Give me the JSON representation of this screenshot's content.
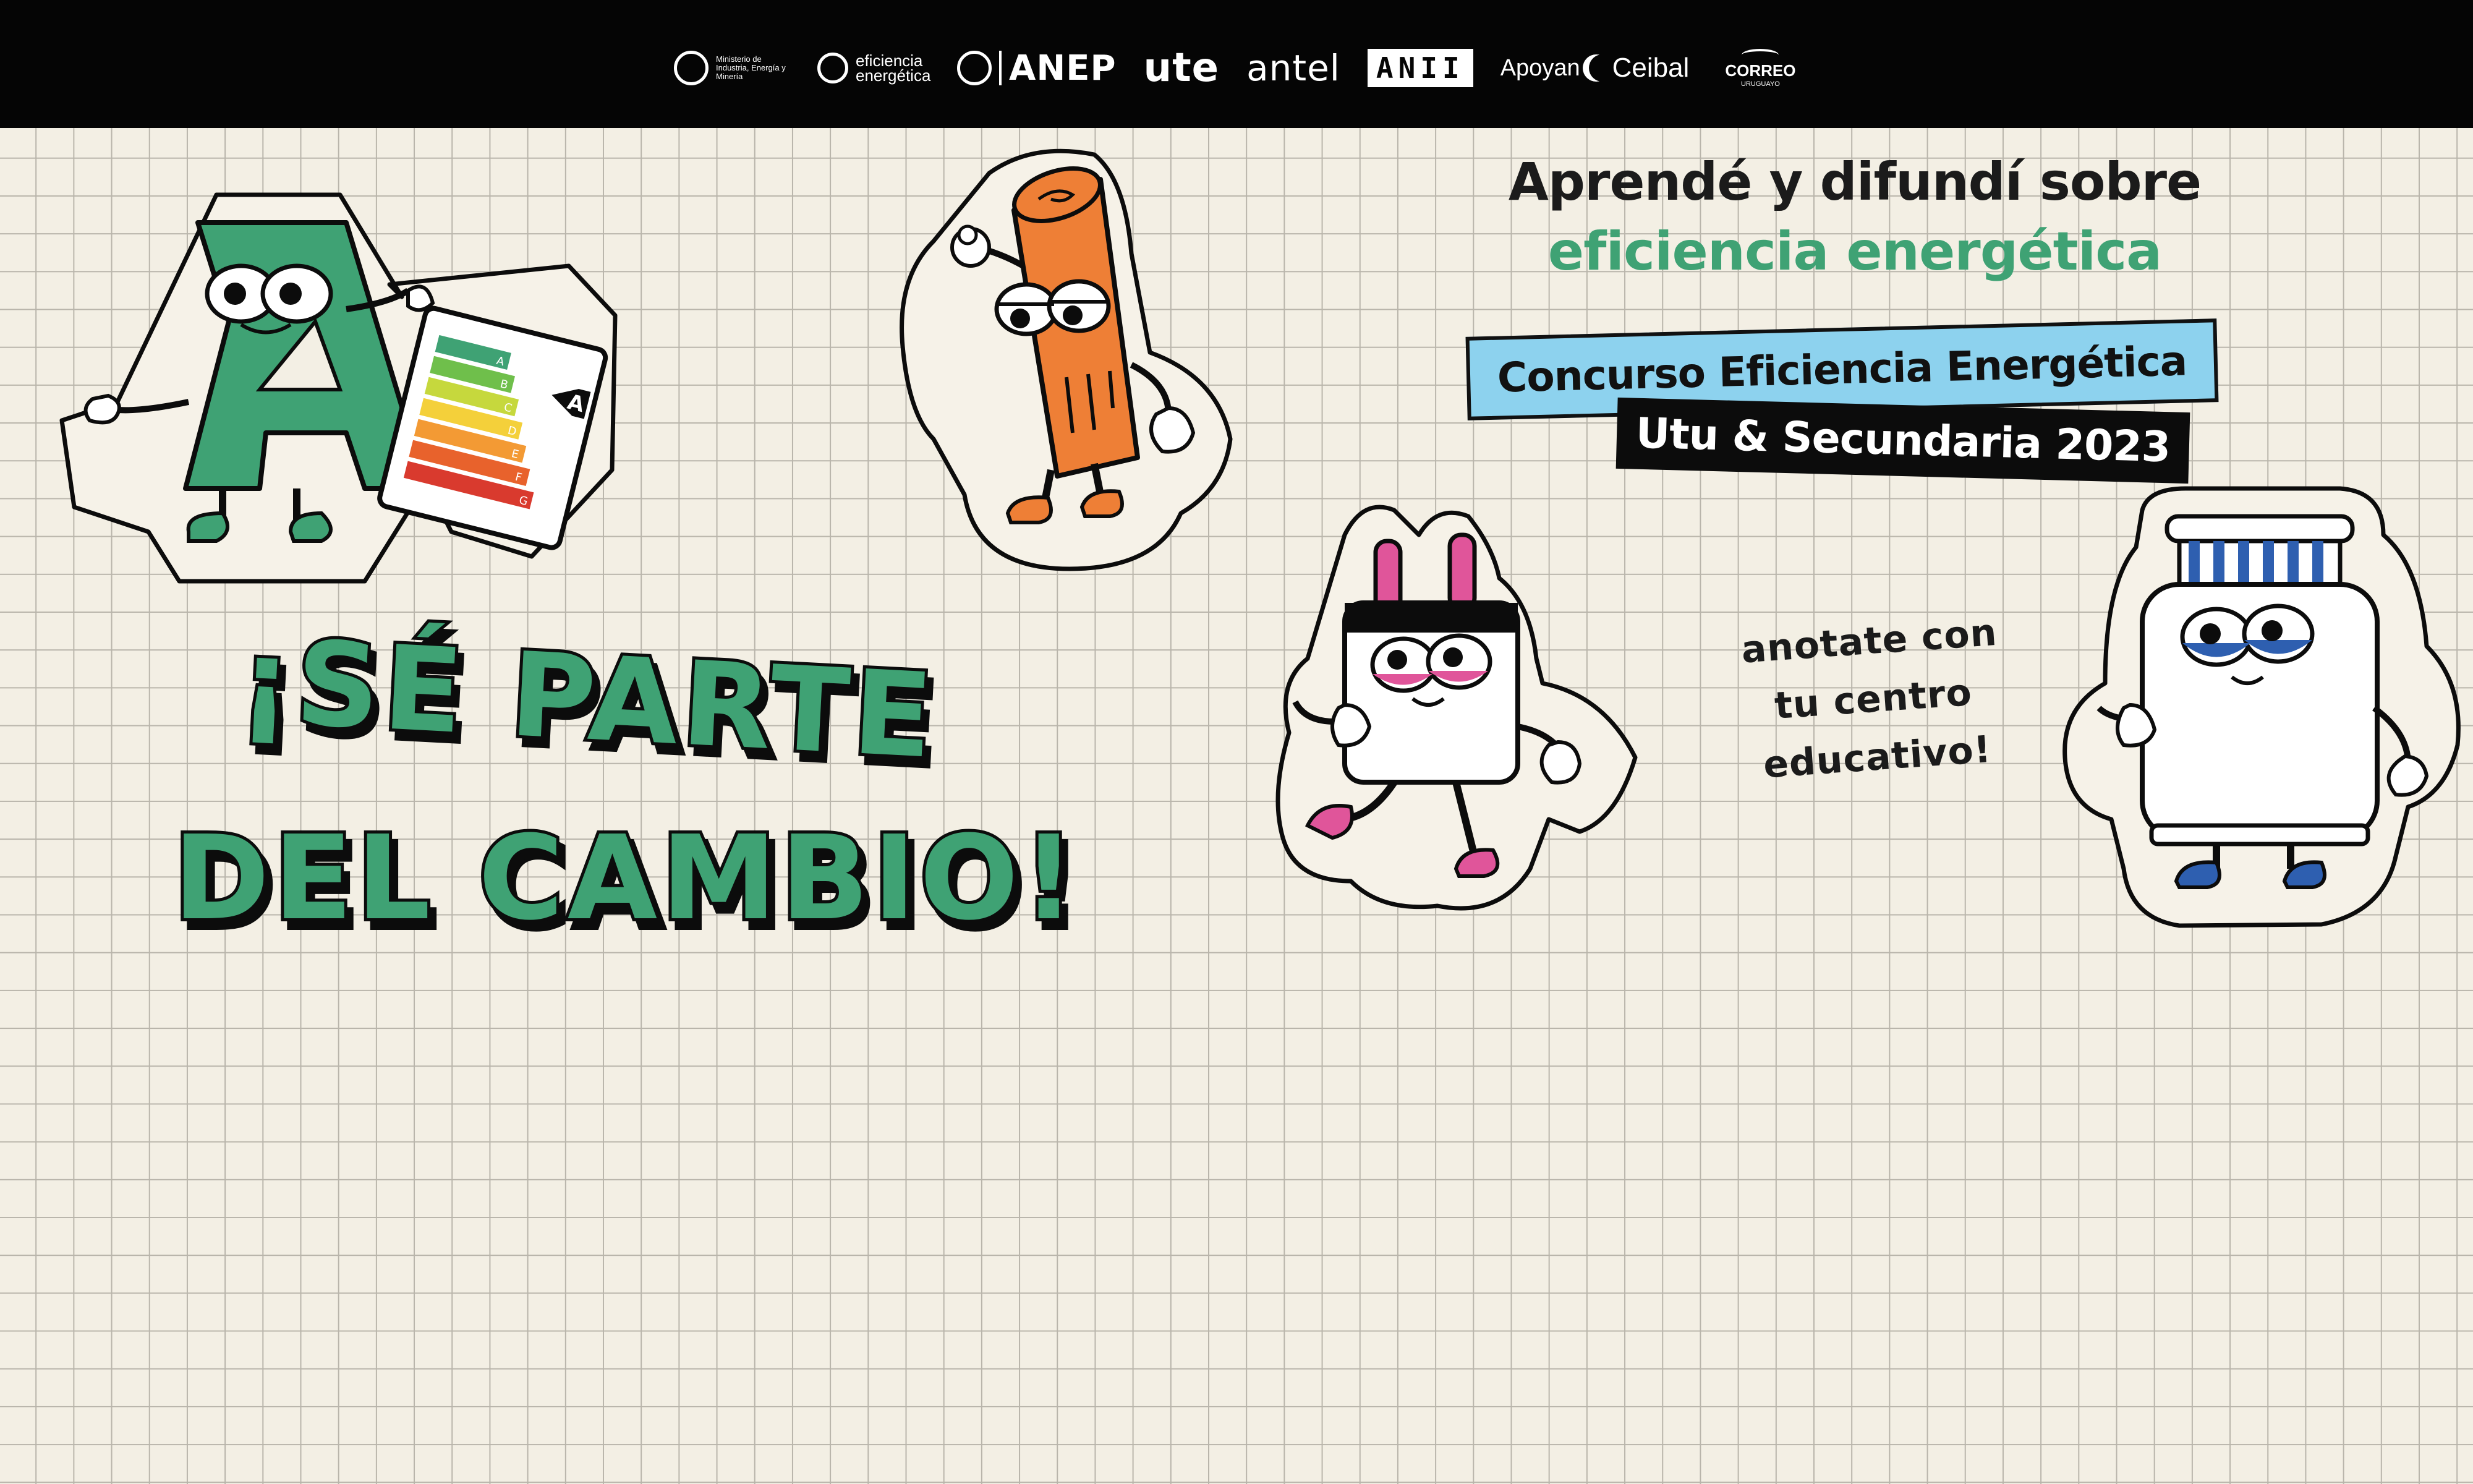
{
  "logos": {
    "ministry": "Ministerio de Industria, Energía y Minería",
    "eficiencia": "eficiencia energética",
    "anep": "ANEP",
    "ute": "ute",
    "antel": "antel",
    "anii": "ANII",
    "apoyan": "Apoyan",
    "ceibal": "Ceibal",
    "correo": "CORREO",
    "correo_sub": "URUGUAYO"
  },
  "headline": {
    "line1": "Aprendé y difundí sobre",
    "line2": "eficiencia energética"
  },
  "contest": {
    "title": "Concurso Eficiencia Energética",
    "subtitle": "Utu & Secundaria 2023"
  },
  "note": {
    "line1": "anotate con",
    "line2": "tu centro",
    "line3": "educativo!"
  },
  "slogan": {
    "line1": "¡SÉ PARTE",
    "line2": "DEL CAMBIO!"
  },
  "label": {
    "letters": [
      "A",
      "B",
      "C",
      "D",
      "E",
      "F",
      "G"
    ],
    "rating": "A"
  },
  "colors": {
    "green": "#3fa274",
    "orange": "#ee7f36",
    "pink": "#e0559a",
    "blue": "#2e5fb0",
    "cyan": "#8dd2ee",
    "cream": "#f3efe4",
    "black": "#0c0c0c"
  }
}
